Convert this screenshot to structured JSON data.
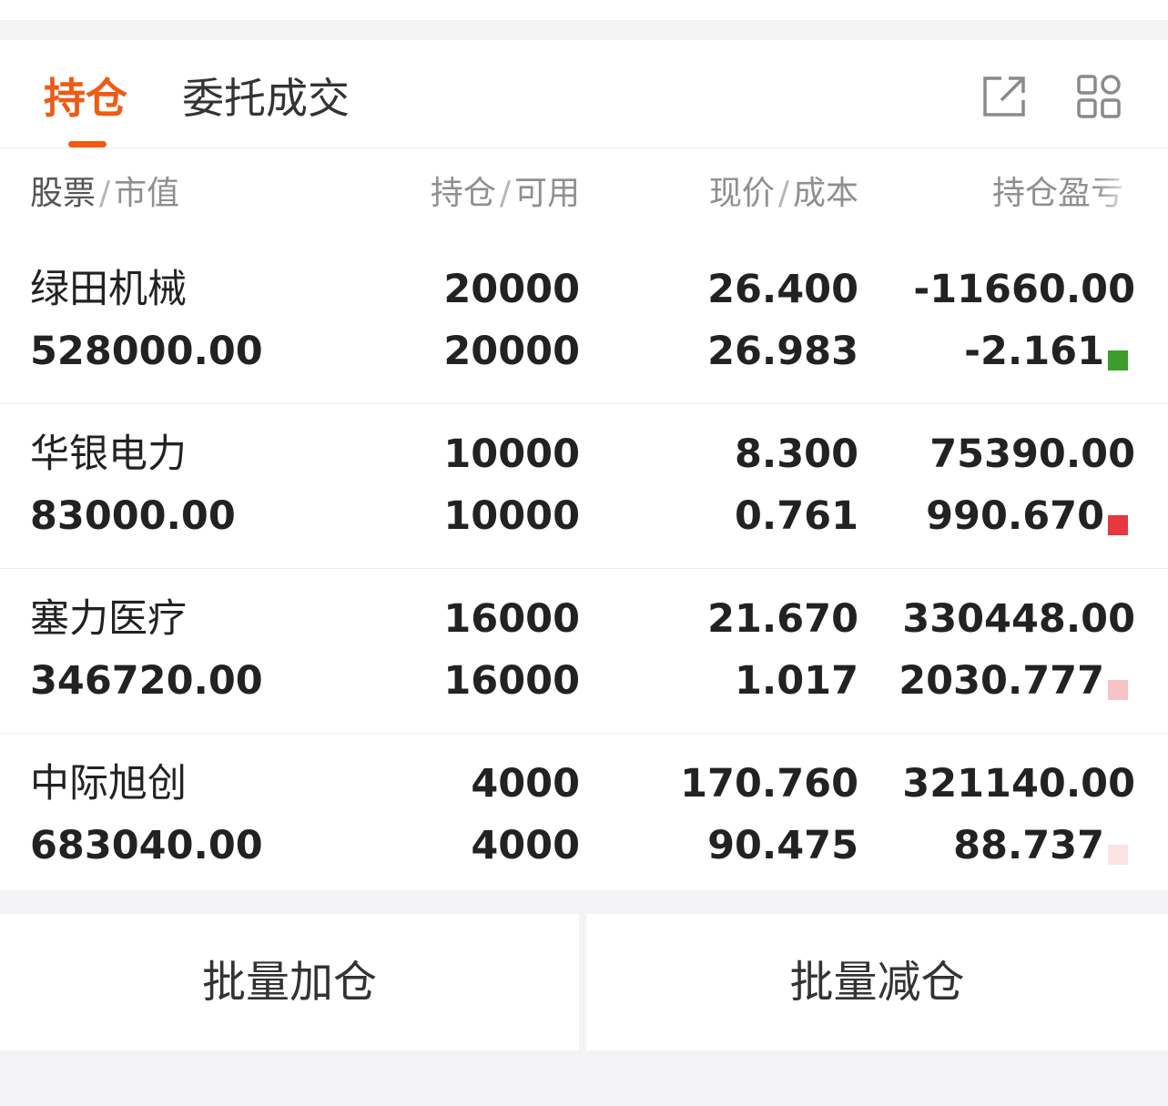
{
  "tabs": [
    {
      "label": "持仓",
      "active": true
    },
    {
      "label": "委托成交",
      "active": false
    }
  ],
  "header_icons": [
    "share-icon",
    "grid-icon"
  ],
  "columns": {
    "stock": {
      "primary": "股票",
      "secondary": "市值"
    },
    "position": {
      "primary": "持仓",
      "secondary": "可用"
    },
    "price": {
      "primary": "现价",
      "secondary": "成本"
    },
    "pnl": {
      "label": "持仓盈亏"
    }
  },
  "colors": {
    "accent": "#f05a12",
    "loss": "#3e9c2a",
    "gain": "#e60012"
  },
  "holdings": [
    {
      "name": "绿田机械",
      "market_value": "528000.00",
      "position": "20000",
      "available": "20000",
      "price": "26.400",
      "cost": "26.983",
      "pnl": "-11660.00",
      "pnl_pct": "-2.161",
      "trend": "loss"
    },
    {
      "name": "华银电力",
      "market_value": "83000.00",
      "position": "10000",
      "available": "10000",
      "price": "8.300",
      "cost": "0.761",
      "pnl": "75390.00",
      "pnl_pct": "990.670",
      "trend": "gain"
    },
    {
      "name": "塞力医疗",
      "market_value": "346720.00",
      "position": "16000",
      "available": "16000",
      "price": "21.670",
      "cost": "1.017",
      "pnl": "330448.00",
      "pnl_pct": "2030.777",
      "trend": "gain"
    },
    {
      "name": "中际旭创",
      "market_value": "683040.00",
      "position": "4000",
      "available": "4000",
      "price": "170.760",
      "cost": "90.475",
      "pnl": "321140.00",
      "pnl_pct": "88.737",
      "trend": "gain"
    }
  ],
  "actions": {
    "batch_add": "批量加仓",
    "batch_reduce": "批量减仓"
  }
}
